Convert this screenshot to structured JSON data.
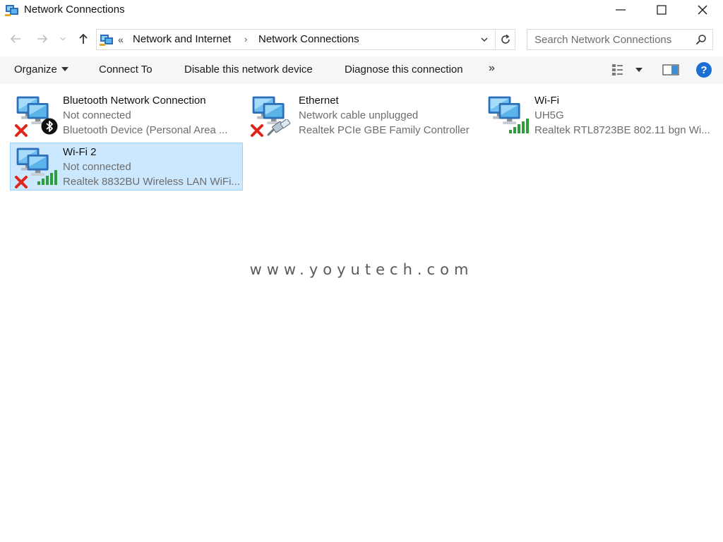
{
  "window": {
    "title": "Network Connections"
  },
  "address": {
    "prefix": "«",
    "crumbs": [
      "Network and Internet",
      "Network Connections"
    ]
  },
  "search": {
    "placeholder": "Search Network Connections"
  },
  "commands": {
    "organize": "Organize",
    "connect_to": "Connect To",
    "disable": "Disable this network device",
    "diagnose": "Diagnose this connection",
    "more": "»",
    "help": "?"
  },
  "connections": [
    {
      "name": "Bluetooth Network Connection",
      "status": "Not connected",
      "device": "Bluetooth Device (Personal Area ...",
      "badge": "red-x",
      "overlay": "bluetooth-icon"
    },
    {
      "name": "Ethernet",
      "status": "Network cable unplugged",
      "device": "Realtek PCIe GBE Family Controller",
      "badge": "red-x",
      "overlay": "ethernet-cable-icon"
    },
    {
      "name": "Wi-Fi",
      "status": "UH5G",
      "device": "Realtek RTL8723BE 802.11 bgn Wi...",
      "badge": "none",
      "overlay": "signal-bars-icon"
    },
    {
      "name": "Wi-Fi 2",
      "status": "Not connected",
      "device": "Realtek 8832BU Wireless LAN WiFi...",
      "badge": "red-x",
      "overlay": "signal-bars-icon",
      "selected": true
    }
  ],
  "watermark": "www.yoyutech.com",
  "colors": {
    "selection_bg": "#cce8ff",
    "selection_border": "#99d1ff",
    "help_blue": "#1a6fd1",
    "error_red": "#e0251b",
    "signal_green": "#2e9e3a"
  }
}
